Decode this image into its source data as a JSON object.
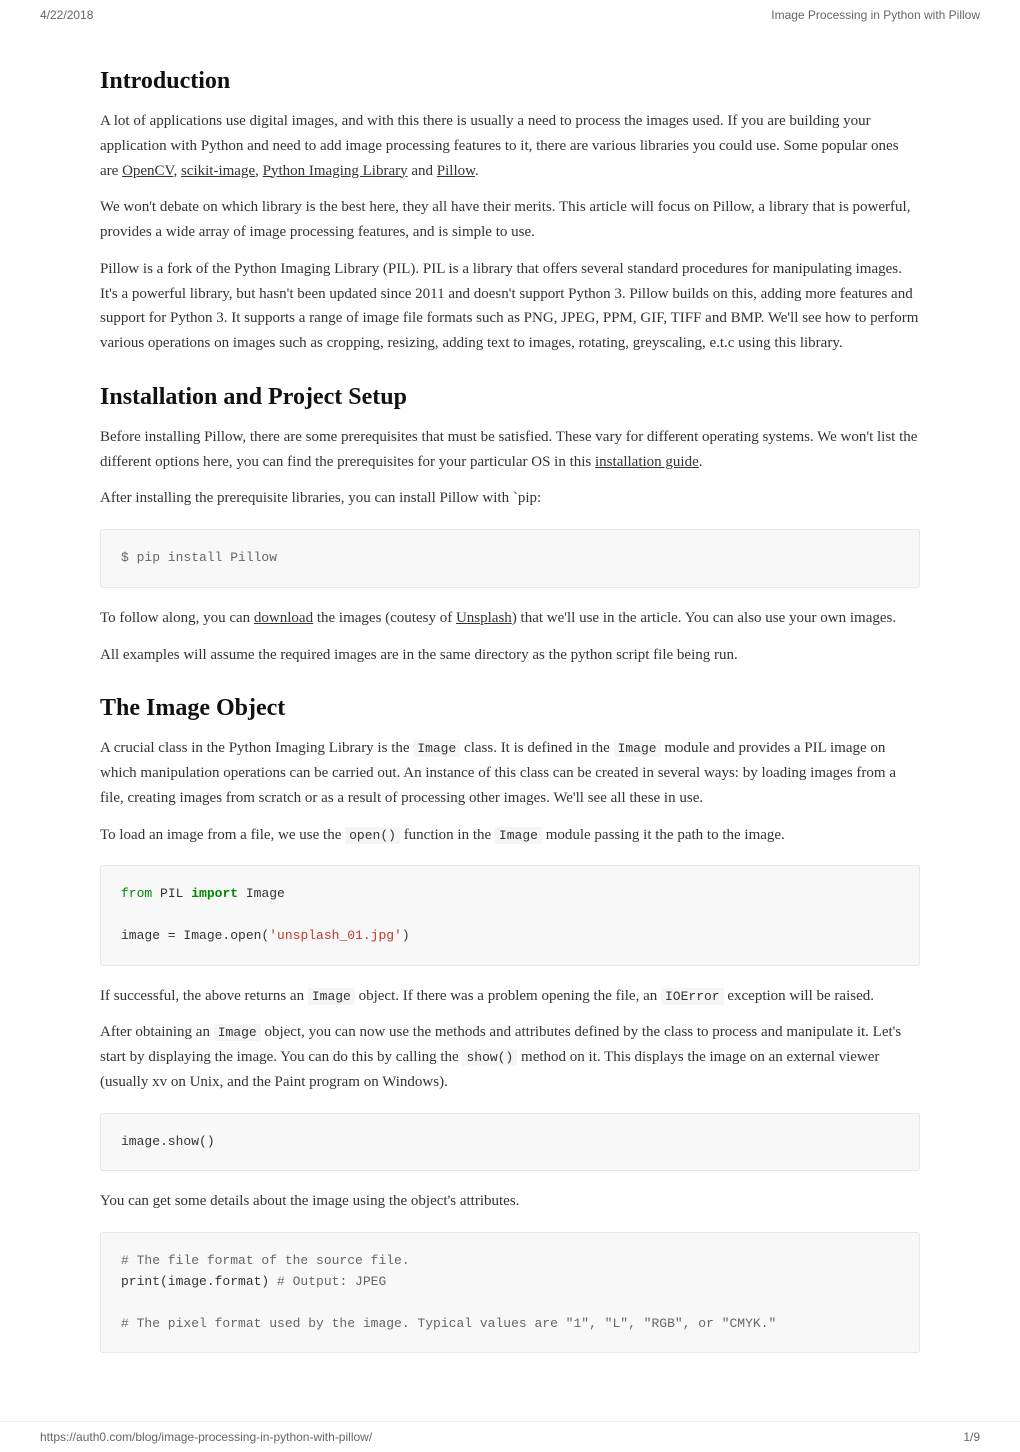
{
  "header": {
    "date": "4/22/2018",
    "title": "Image Processing in Python with Pillow"
  },
  "footer": {
    "url": "https://auth0.com/blog/image-processing-in-python-with-pillow/",
    "page": "1/9"
  },
  "sections": [
    {
      "id": "introduction",
      "heading": "Introduction",
      "paragraphs": [
        "A lot of applications use digital images, and with this there is usually a need to process the images used. If you are building your application with Python and need to add image processing features to it, there are various libraries you could use. Some popular ones are OpenCV, scikit-image, Python Imaging Library and Pillow.",
        "We won't debate on which library is the best here, they all have their merits. This article will focus on Pillow, a library that is powerful, provides a wide array of image processing features, and is simple to use.",
        "Pillow is a fork of the Python Imaging Library (PIL). PIL is a library that offers several standard procedures for manipulating images. It's a powerful library, but hasn't been updated since 2011 and doesn't support Python 3. Pillow builds on this, adding more features and support for Python 3. It supports a range of image file formats such as PNG, JPEG, PPM, GIF, TIFF and BMP. We'll see how to perform various operations on images such as cropping, resizing, adding text to images, rotating, greyscaling, e.t.c using this library."
      ]
    },
    {
      "id": "installation",
      "heading": "Installation and Project Setup",
      "paragraphs": [
        "Before installing Pillow, there are some prerequisites that must be satisfied. These vary for different operating systems. We won't list the different options here, you can find the prerequisites for your particular OS in this installation guide.",
        "After installing the prerequisite libraries, you can install Pillow with `pip:"
      ],
      "code_block_1": "$ pip install Pillow",
      "paragraphs2": [
        "To follow along, you can download the images (coutesy of Unsplash) that we'll use in the article. You can also use your own images.",
        "All examples will assume the required images are in the same directory as the python script file being run."
      ]
    },
    {
      "id": "image-object",
      "heading": "The Image Object",
      "paragraphs": [
        "A crucial class in the Python Imaging Library is the  Image  class. It is defined in the  Image  module and provides a PIL image on which manipulation operations can be carried out. An instance of this class can be created in several ways: by loading images from a file, creating images from scratch or as a result of processing other images. We'll see all these in use.",
        "To load an image from a file, we use the  open()  function in the  Image  module passing it the path to the image."
      ],
      "code_block_2_lines": [
        {
          "type": "keyword-from",
          "text": "from"
        },
        {
          "type": "normal",
          "text": " PIL "
        },
        {
          "type": "keyword-import",
          "text": "import"
        },
        {
          "type": "normal",
          "text": " Image"
        },
        {
          "type": "blank",
          "text": ""
        },
        {
          "type": "normal",
          "text": "image = Image.open("
        },
        {
          "type": "string",
          "text": "'unsplash_01.jpg'"
        },
        {
          "type": "normal",
          "text": ")"
        }
      ],
      "paragraphs2": [
        "If successful, the above returns an  Image  object. If there was a problem opening the file, an  IOError  exception will be raised.",
        "After obtaining an  Image  object, you can now use the methods and attributes defined by the class to process and manipulate it. Let's start by displaying the image. You can do this by calling the  show()  method on it. This displays the image on an external viewer (usually xv on Unix, and the Paint program on Windows)."
      ],
      "code_block_3": "image.show()",
      "paragraphs3": [
        "You can get some details about the image using the object's attributes."
      ],
      "code_block_4_lines": [
        "# The file format of the source file.",
        "print(image.format) # Output: JPEG",
        "",
        "# The pixel format used by the image. Typical values are \"1\", \"L\", \"RGB\", or \"CMYK.\""
      ]
    }
  ]
}
